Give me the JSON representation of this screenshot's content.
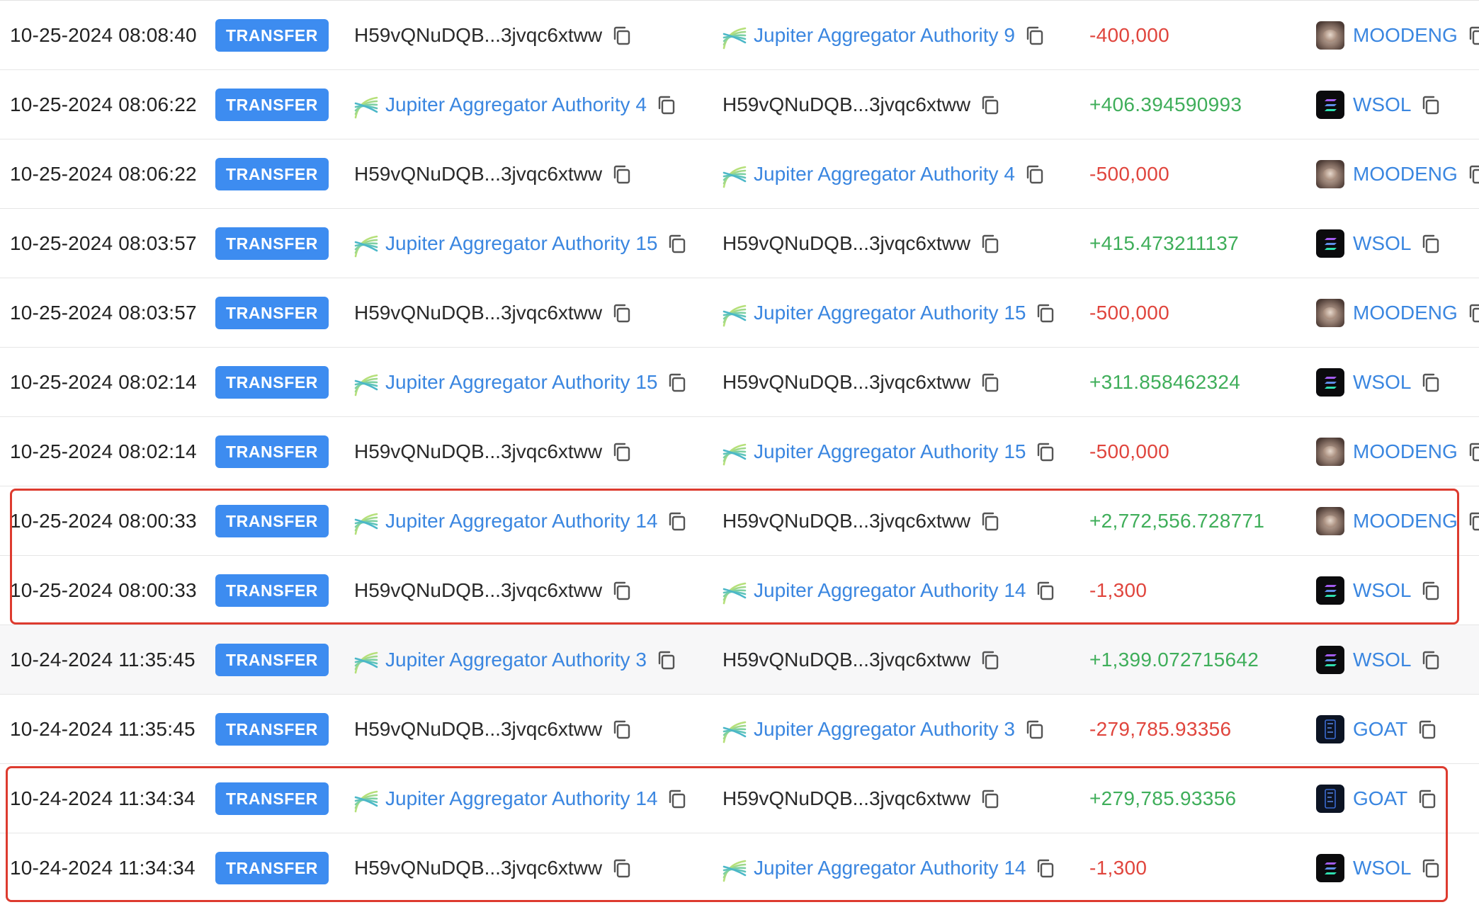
{
  "badge_label": "TRANSFER",
  "colors": {
    "badge": "#3d8cf0",
    "link": "#3a86e0",
    "positive": "#3fae5a",
    "negative": "#e0453d",
    "highlight": "#dd3b2f"
  },
  "rows": [
    {
      "time": "10-25-2024 08:08:40",
      "from": "H59vQNuDQB...3jvqc6xtww",
      "from_is_jupiter": false,
      "to": "Jupiter Aggregator Authority 9",
      "to_is_jupiter": true,
      "amount": "-400,000",
      "direction": "negative",
      "token": "MOODENG",
      "token_icon": "moodeng-token-icon"
    },
    {
      "time": "10-25-2024 08:06:22",
      "from": "Jupiter Aggregator Authority 4",
      "from_is_jupiter": true,
      "to": "H59vQNuDQB...3jvqc6xtww",
      "to_is_jupiter": false,
      "amount": "+406.394590993",
      "direction": "positive",
      "token": "WSOL",
      "token_icon": "wsol-token-icon"
    },
    {
      "time": "10-25-2024 08:06:22",
      "from": "H59vQNuDQB...3jvqc6xtww",
      "from_is_jupiter": false,
      "to": "Jupiter Aggregator Authority 4",
      "to_is_jupiter": true,
      "amount": "-500,000",
      "direction": "negative",
      "token": "MOODENG",
      "token_icon": "moodeng-token-icon"
    },
    {
      "time": "10-25-2024 08:03:57",
      "from": "Jupiter Aggregator Authority 15",
      "from_is_jupiter": true,
      "to": "H59vQNuDQB...3jvqc6xtww",
      "to_is_jupiter": false,
      "amount": "+415.473211137",
      "direction": "positive",
      "token": "WSOL",
      "token_icon": "wsol-token-icon"
    },
    {
      "time": "10-25-2024 08:03:57",
      "from": "H59vQNuDQB...3jvqc6xtww",
      "from_is_jupiter": false,
      "to": "Jupiter Aggregator Authority 15",
      "to_is_jupiter": true,
      "amount": "-500,000",
      "direction": "negative",
      "token": "MOODENG",
      "token_icon": "moodeng-token-icon"
    },
    {
      "time": "10-25-2024 08:02:14",
      "from": "Jupiter Aggregator Authority 15",
      "from_is_jupiter": true,
      "to": "H59vQNuDQB...3jvqc6xtww",
      "to_is_jupiter": false,
      "amount": "+311.858462324",
      "direction": "positive",
      "token": "WSOL",
      "token_icon": "wsol-token-icon"
    },
    {
      "time": "10-25-2024 08:02:14",
      "from": "H59vQNuDQB...3jvqc6xtww",
      "from_is_jupiter": false,
      "to": "Jupiter Aggregator Authority 15",
      "to_is_jupiter": true,
      "amount": "-500,000",
      "direction": "negative",
      "token": "MOODENG",
      "token_icon": "moodeng-token-icon"
    },
    {
      "time": "10-25-2024 08:00:33",
      "from": "Jupiter Aggregator Authority 14",
      "from_is_jupiter": true,
      "to": "H59vQNuDQB...3jvqc6xtww",
      "to_is_jupiter": false,
      "amount": "+2,772,556.728771",
      "direction": "positive",
      "token": "MOODENG",
      "token_icon": "moodeng-token-icon"
    },
    {
      "time": "10-25-2024 08:00:33",
      "from": "H59vQNuDQB...3jvqc6xtww",
      "from_is_jupiter": false,
      "to": "Jupiter Aggregator Authority 14",
      "to_is_jupiter": true,
      "amount": "-1,300",
      "direction": "negative",
      "token": "WSOL",
      "token_icon": "wsol-token-icon"
    },
    {
      "time": "10-24-2024 11:35:45",
      "from": "Jupiter Aggregator Authority 3",
      "from_is_jupiter": true,
      "to": "H59vQNuDQB...3jvqc6xtww",
      "to_is_jupiter": false,
      "amount": "+1,399.072715642",
      "direction": "positive",
      "token": "WSOL",
      "token_icon": "wsol-token-icon"
    },
    {
      "time": "10-24-2024 11:35:45",
      "from": "H59vQNuDQB...3jvqc6xtww",
      "from_is_jupiter": false,
      "to": "Jupiter Aggregator Authority 3",
      "to_is_jupiter": true,
      "amount": "-279,785.93356",
      "direction": "negative",
      "token": "GOAT",
      "token_icon": "goat-token-icon"
    },
    {
      "time": "10-24-2024 11:34:34",
      "from": "Jupiter Aggregator Authority 14",
      "from_is_jupiter": true,
      "to": "H59vQNuDQB...3jvqc6xtww",
      "to_is_jupiter": false,
      "amount": "+279,785.93356",
      "direction": "positive",
      "token": "GOAT",
      "token_icon": "goat-token-icon"
    },
    {
      "time": "10-24-2024 11:34:34",
      "from": "H59vQNuDQB...3jvqc6xtww",
      "from_is_jupiter": false,
      "to": "Jupiter Aggregator Authority 14",
      "to_is_jupiter": true,
      "amount": "-1,300",
      "direction": "negative",
      "token": "WSOL",
      "token_icon": "wsol-token-icon"
    }
  ],
  "highlighted_groups": [
    {
      "rows": [
        7,
        8
      ]
    },
    {
      "rows": [
        11,
        12
      ]
    }
  ]
}
